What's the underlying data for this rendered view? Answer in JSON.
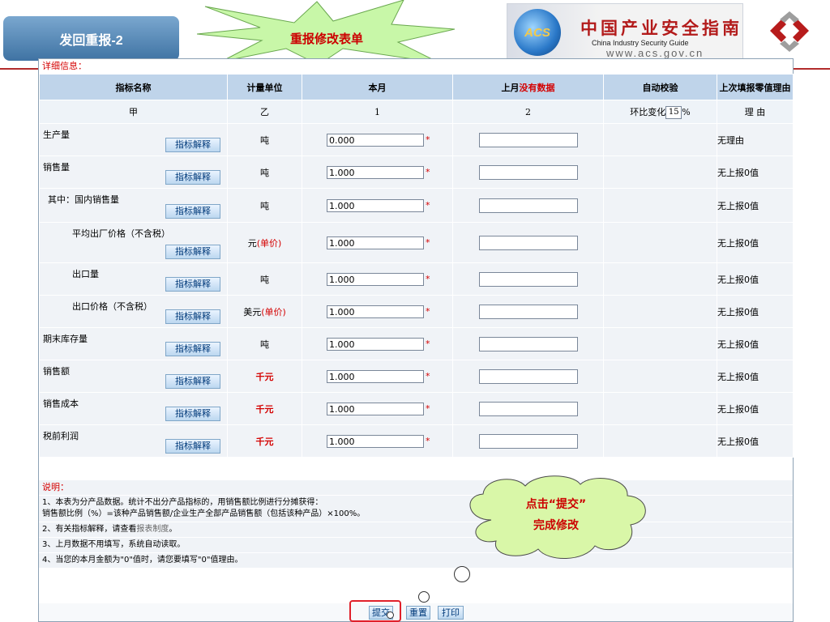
{
  "slide": {
    "title": "发回重报-2",
    "callout": "重报修改表单",
    "cloud_line1": "点击“提交”",
    "cloud_line2": "完成修改"
  },
  "logo": {
    "acs": "ACS",
    "cn": "中国产业安全指南",
    "en": "China  Industry  Security  Guide",
    "url": "www.acs.gov.cn"
  },
  "form": {
    "section_title": "详细信息：",
    "headers": {
      "name": "指标名称",
      "unit": "计量单位",
      "current": "本月",
      "prev_prefix": "上月",
      "prev_nodata": "没有数据",
      "auto_check": "自动校验",
      "reason": "上次填报零值理由"
    },
    "sub": {
      "name": "甲",
      "unit": "乙",
      "current": "1",
      "prev": "2",
      "check_prefix": "环比变化",
      "check_value": "15",
      "check_suffix": "%",
      "reason": "理 由"
    },
    "explain_label": "指标解释",
    "rows": [
      {
        "name": "生产量",
        "unit": "吨",
        "unit_note": "",
        "current": "0.000",
        "reason": "无理由"
      },
      {
        "name": "销售量",
        "unit": "吨",
        "unit_note": "",
        "current": "1.000",
        "reason": "无上报0值"
      },
      {
        "name": "其中：国内销售量",
        "unit": "吨",
        "unit_note": "",
        "current": "1.000",
        "reason": "无上报0值"
      },
      {
        "name": "平均出厂价格（不含税）",
        "unit": "元",
        "unit_note": "(单价)",
        "current": "1.000",
        "reason": "无上报0值"
      },
      {
        "name": "出口量",
        "unit": "吨",
        "unit_note": "",
        "current": "1.000",
        "reason": "无上报0值"
      },
      {
        "name": "出口价格（不含税）",
        "unit": "美元",
        "unit_note": "(单价)",
        "current": "1.000",
        "reason": "无上报0值"
      },
      {
        "name": "期末库存量",
        "unit": "吨",
        "unit_note": "",
        "current": "1.000",
        "reason": "无上报0值"
      },
      {
        "name": "销售额",
        "unit": "千元",
        "unit_note": "",
        "current": "1.000",
        "reason": "无上报0值"
      },
      {
        "name": "销售成本",
        "unit": "千元",
        "unit_note": "",
        "current": "1.000",
        "reason": "无上报0值"
      },
      {
        "name": "税前利润",
        "unit": "千元",
        "unit_note": "",
        "current": "1.000",
        "reason": "无上报0值"
      }
    ],
    "required_mark": "*"
  },
  "notes": {
    "title": "说明：",
    "n1a": "1、本表为分产品数据。统计不出分产品指标的，用销售额比例进行分摊获得：",
    "n1b": "销售额比例（%）=该种产品销售额/企业生产全部产品销售额（包括该种产品）×100%。",
    "n2a": "2、有关指标解释，请查看",
    "n2b": "报表制度",
    "n2c": "。",
    "n3": "3、上月数据不用填写，系统自动读取。",
    "n4": "4、当您的本月金额为\"0\"值时，请您要填写\"0\"值理由。"
  },
  "actions": {
    "submit": "提交",
    "reset": "重置",
    "print": "打印"
  },
  "colors": {
    "accent_red": "#d40000",
    "header_blue": "#bfd4ea",
    "row_bg": "#f0f3f7",
    "star_green": "#c8f7a8"
  }
}
